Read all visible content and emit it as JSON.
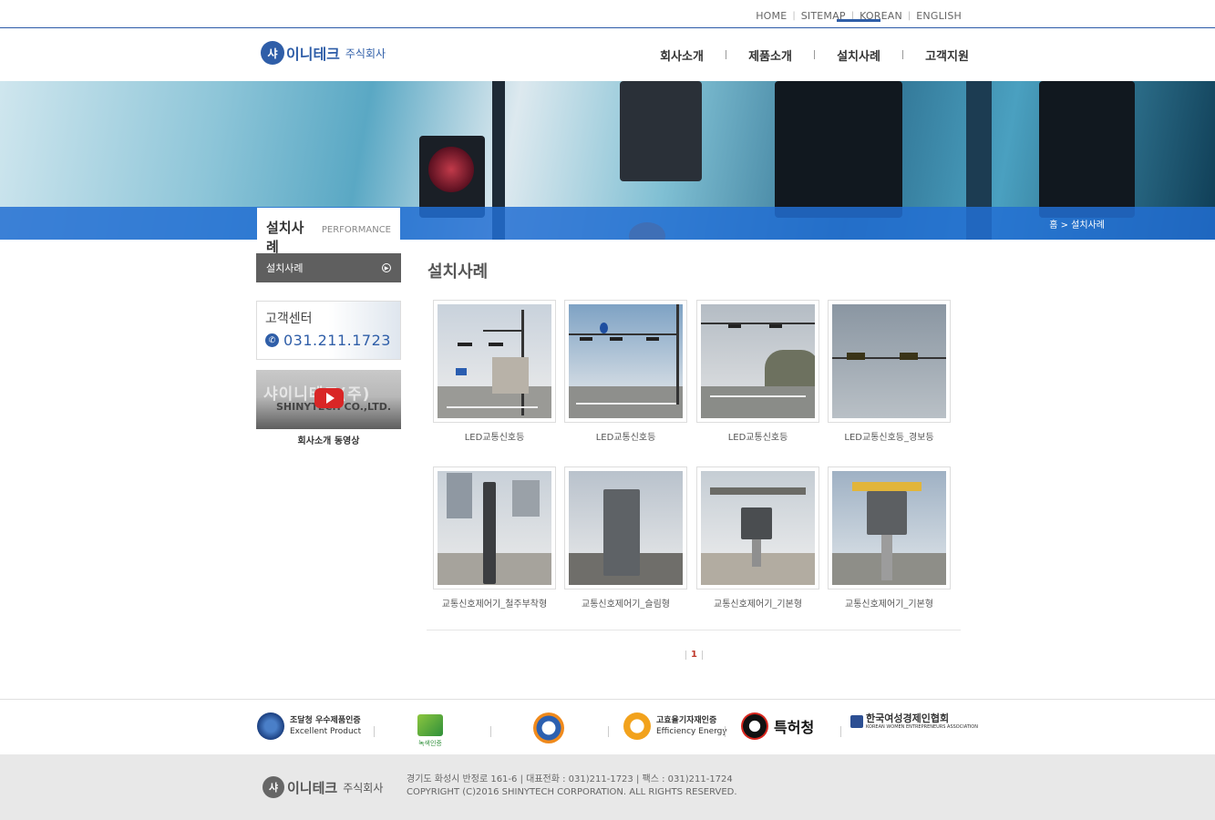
{
  "top_links": [
    "HOME",
    "SITEMAP",
    "KOREAN",
    "ENGLISH"
  ],
  "logo": {
    "mark": "샤",
    "name": "이니테크",
    "corp": "주식회사"
  },
  "nav": [
    "회사소개",
    "제품소개",
    "설치사례",
    "고객지원"
  ],
  "nav_active": "설치사례",
  "banner": {
    "title_ko": "설치사례",
    "title_en": "PERFORMANCE",
    "breadcrumb": "홈 > 설치사례"
  },
  "sidebar": {
    "menu_item": "설치사례",
    "cs_title": "고객센터",
    "cs_phone": "031.211.1723",
    "video_sign": "샤이니테크(주)",
    "video_sign2": "SHINYTECH CO.,LTD.",
    "video_caption": "회사소개 동영상"
  },
  "content_title": "설치사례",
  "gallery": [
    {
      "caption": "LED교통신호등"
    },
    {
      "caption": "LED교통신호등"
    },
    {
      "caption": "LED교통신호등"
    },
    {
      "caption": "LED교통신호등_경보등"
    },
    {
      "caption": "교통신호제어기_철주부착형"
    },
    {
      "caption": "교통신호제어기_슬림형"
    },
    {
      "caption": "교통신호제어기_기본형"
    },
    {
      "caption": "교통신호제어기_기본형"
    }
  ],
  "pagination": {
    "current": "1"
  },
  "certs": [
    {
      "line1": "조달청 우수제품인증",
      "line2": "Excellent Product"
    },
    {
      "line1": "녹색인증",
      "line2": ""
    },
    {
      "line1": "",
      "line2": ""
    },
    {
      "line1": "고효율기자재인증",
      "line2": "Efficiency Energy"
    },
    {
      "line1": "특허청",
      "line2": ""
    },
    {
      "line1": "한국여성경제인협회",
      "line2": "KOREAN WOMEN ENTREPRENEURS ASSOCIATION"
    }
  ],
  "footer": {
    "address": "경기도 화성시 반정로 161-6  |  대표전화 : 031)211-1723  |  팩스 : 031)211-1724",
    "copyright": "COPYRIGHT (C)2016 SHINYTECH CORPORATION. ALL RIGHTS RESERVED."
  },
  "colors": {
    "brand": "#2f5ea8",
    "banner_band": "#226ed2",
    "sidebar_menu": "#5f5f5f",
    "pager_active": "#c0392b"
  }
}
